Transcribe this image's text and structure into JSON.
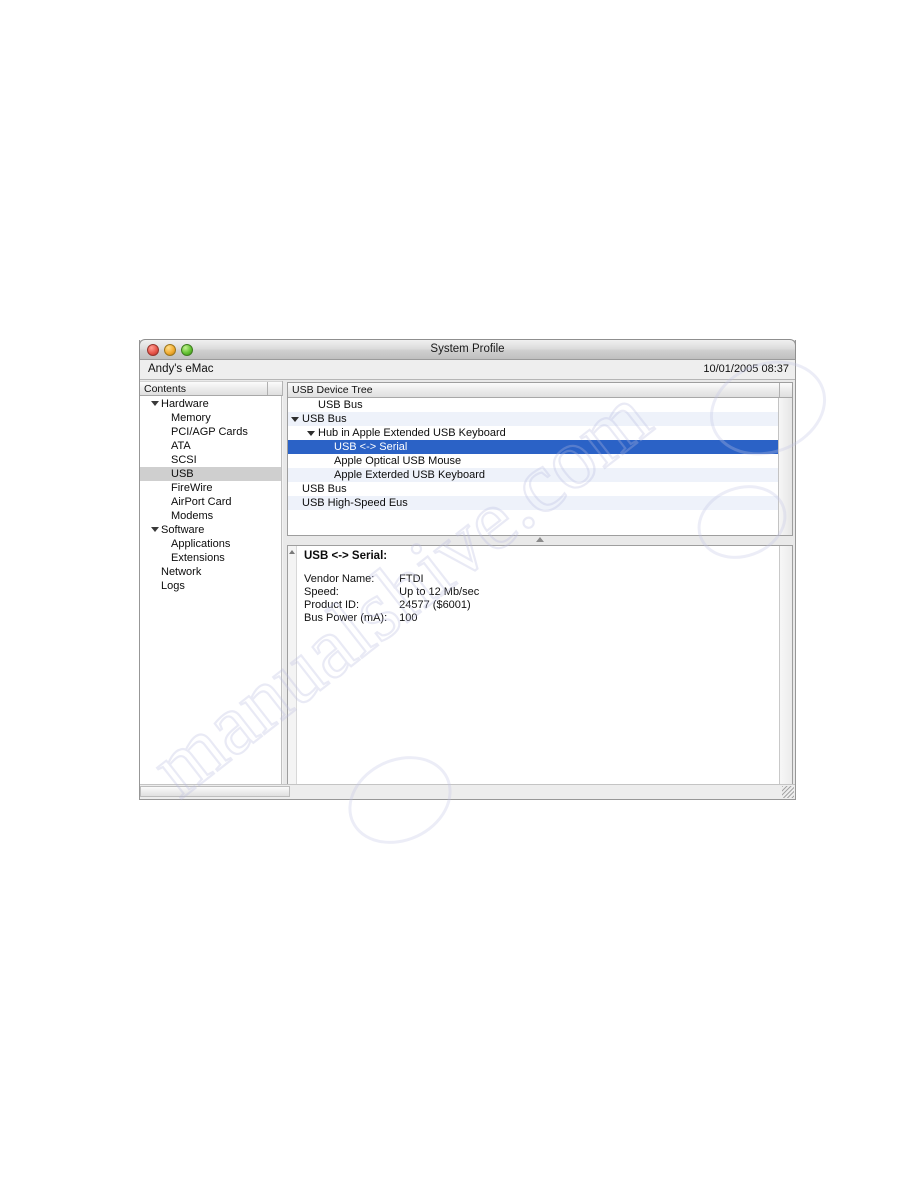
{
  "window": {
    "title": "System Profile",
    "machine_name": "Andy's eMac",
    "datetime": "10/01/2005 08:37",
    "controls": {
      "close": "close-button",
      "minimize": "minimize-button",
      "zoom": "zoom-button"
    }
  },
  "sidebar": {
    "header": "Contents",
    "items": [
      {
        "label": "Hardware",
        "level": 0,
        "disclosure": true,
        "selected": false
      },
      {
        "label": "Memory",
        "level": 1,
        "disclosure": false,
        "selected": false
      },
      {
        "label": "PCI/AGP Cards",
        "level": 1,
        "disclosure": false,
        "selected": false
      },
      {
        "label": "ATA",
        "level": 1,
        "disclosure": false,
        "selected": false
      },
      {
        "label": "SCSI",
        "level": 1,
        "disclosure": false,
        "selected": false
      },
      {
        "label": "USB",
        "level": 1,
        "disclosure": false,
        "selected": true
      },
      {
        "label": "FireWire",
        "level": 1,
        "disclosure": false,
        "selected": false
      },
      {
        "label": "AirPort Card",
        "level": 1,
        "disclosure": false,
        "selected": false
      },
      {
        "label": "Modems",
        "level": 1,
        "disclosure": false,
        "selected": false
      },
      {
        "label": "Software",
        "level": 0,
        "disclosure": true,
        "selected": false
      },
      {
        "label": "Applications",
        "level": 1,
        "disclosure": false,
        "selected": false
      },
      {
        "label": "Extensions",
        "level": 1,
        "disclosure": false,
        "selected": false
      },
      {
        "label": "Network",
        "level": 0,
        "disclosure": false,
        "selected": false
      },
      {
        "label": "Logs",
        "level": 0,
        "disclosure": false,
        "selected": false
      }
    ]
  },
  "tree": {
    "header": "USB Device Tree",
    "rows": [
      {
        "label": "USB Bus",
        "indent": 1,
        "disclosure": "none",
        "selected": false
      },
      {
        "label": "USB Bus",
        "indent": 0,
        "disclosure": "expanded",
        "selected": false
      },
      {
        "label": "Hub in Apple Extended USB Keyboard",
        "indent": 1,
        "disclosure": "expanded",
        "selected": false
      },
      {
        "label": "USB <-> Serial",
        "indent": 2,
        "disclosure": "none",
        "selected": true
      },
      {
        "label": "Apple Optical USB Mouse",
        "indent": 2,
        "disclosure": "none",
        "selected": false
      },
      {
        "label": "Apple Exterded USB Keyboard",
        "indent": 2,
        "disclosure": "none",
        "selected": false
      },
      {
        "label": "USB Bus",
        "indent": 0,
        "disclosure": "none",
        "selected": false
      },
      {
        "label": "USB High-Speed Eus",
        "indent": 0,
        "disclosure": "none",
        "selected": false
      }
    ]
  },
  "detail": {
    "title": "USB <-> Serial:",
    "rows": [
      {
        "key": "Vendor Name:",
        "value": "FTDI"
      },
      {
        "key": "Speed:",
        "value": "Up to 12 Mb/sec"
      },
      {
        "key": "Product ID:",
        "value": "24577 ($6001)"
      },
      {
        "key": "Bus Power (mA):",
        "value": "100"
      }
    ]
  },
  "colors": {
    "selection_blue": "#2b62c6",
    "sidebar_selection": "#cfcfcf",
    "stripe": "#eef2fa"
  },
  "watermark": {
    "text": "manualshive.com"
  }
}
